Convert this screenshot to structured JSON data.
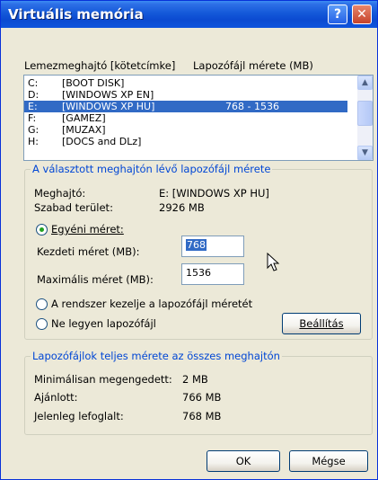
{
  "window": {
    "title": "Virtuális memória",
    "help_icon": "?",
    "close_icon": "✕"
  },
  "list": {
    "header_drive": "Lemezmeghajtó [kötetcímke]",
    "header_size": "Lapozófájl mérete (MB)",
    "rows": [
      {
        "letter": "C:",
        "label": "[BOOT DISK]",
        "size": "",
        "selected": false
      },
      {
        "letter": "D:",
        "label": "[WINDOWS XP EN]",
        "size": "",
        "selected": false
      },
      {
        "letter": "E:",
        "label": "[WINDOWS XP HU]",
        "size": "768 - 1536",
        "selected": true
      },
      {
        "letter": "F:",
        "label": "[GAMEZ]",
        "size": "",
        "selected": false
      },
      {
        "letter": "G:",
        "label": "[MUZAX]",
        "size": "",
        "selected": false
      },
      {
        "letter": "H:",
        "label": "[DOCS and DLz]",
        "size": "",
        "selected": false
      }
    ],
    "scroll_up": "▲",
    "scroll_down": "▼"
  },
  "selected_drive": {
    "legend": "A választott meghajtón lévő lapozófájl mérete",
    "drive_label": "Meghajtó:",
    "drive_value": "E:  [WINDOWS XP HU]",
    "free_label": "Szabad terület:",
    "free_value": "2926 MB",
    "custom_label": "Egyéni méret:",
    "initial_label": "Kezdeti méret (MB):",
    "initial_value": "768",
    "max_label": "Maximális méret (MB):",
    "max_value": "1536",
    "system_managed_label": "A rendszer kezelje a lapozófájl méretét",
    "no_pagefile_label": "Ne legyen lapozófájl",
    "set_button": "Beállítás"
  },
  "totals": {
    "legend": "Lapozófájlok teljes mérete az összes meghajtón",
    "min_label": "Minimálisan megengedett:",
    "min_value": "2 MB",
    "recommended_label": "Ajánlott:",
    "recommended_value": "766 MB",
    "current_label": "Jelenleg lefoglalt:",
    "current_value": "768 MB"
  },
  "buttons": {
    "ok": "OK",
    "cancel": "Mégse"
  }
}
